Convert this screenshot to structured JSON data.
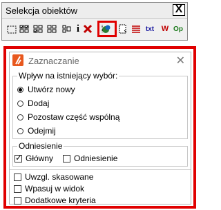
{
  "toolbar_window": {
    "title": "Selekcja obiektów",
    "close": "X",
    "tools": [
      {
        "name": "select-rect-dashed-icon"
      },
      {
        "name": "grid-select-icon"
      },
      {
        "name": "grid-select-2-icon"
      },
      {
        "name": "grid-select-3-icon"
      },
      {
        "name": "info-icon",
        "text": "i"
      },
      {
        "name": "delete-x-icon"
      },
      {
        "name": "object-select-icon"
      },
      {
        "name": "document-select-icon"
      },
      {
        "name": "list-red-icon"
      },
      {
        "name": "txt-icon",
        "text": "txt"
      },
      {
        "name": "w-icon",
        "text": "W"
      },
      {
        "name": "op-icon",
        "text": "Op"
      }
    ]
  },
  "dialog": {
    "title": "Zaznaczanie",
    "close": "✕",
    "influence_group": {
      "legend": "Wpływ na istniejący wybór:",
      "options": [
        {
          "label": "Utwórz nowy",
          "selected": true
        },
        {
          "label": "Dodaj",
          "selected": false
        },
        {
          "label": "Pozostaw część wspólną",
          "selected": false
        },
        {
          "label": "Odejmij",
          "selected": false
        }
      ]
    },
    "reference_group": {
      "legend": "Odniesienie",
      "main": {
        "label": "Główny",
        "checked": true
      },
      "ref": {
        "label": "Odniesienie",
        "checked": false
      }
    },
    "checks": [
      {
        "label": "Uwzgl. skasowane",
        "checked": false
      },
      {
        "label": "Wpasuj w widok",
        "checked": false
      },
      {
        "label": "Dodatkowe kryteria",
        "checked": false
      }
    ]
  },
  "colors": {
    "highlight": "#e00000",
    "accent_icon": "#e8581e"
  }
}
